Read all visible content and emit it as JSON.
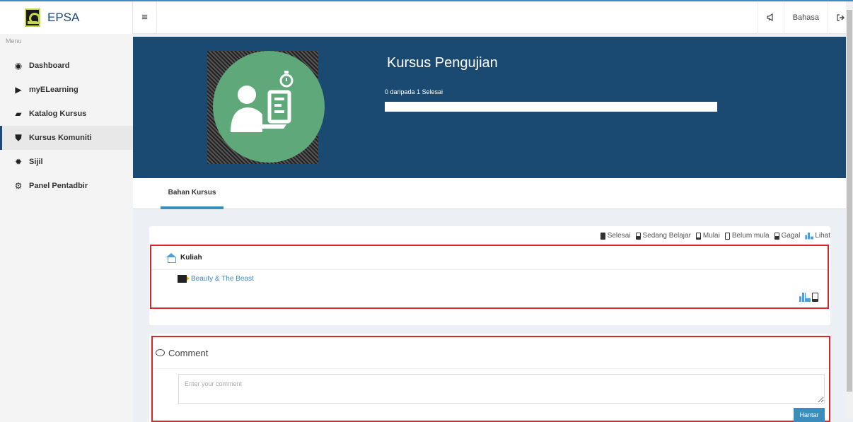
{
  "brand": {
    "name": "EPSA"
  },
  "navbar": {
    "menu_toggle": "≡",
    "announce_icon": "megaphone-icon",
    "language_label": "Bahasa",
    "logout_icon": "sign-out-icon"
  },
  "sidebar": {
    "menu_heading": "Menu",
    "items": [
      {
        "label": "Dashboard",
        "icon": "dashboard-icon",
        "glyph": "◉",
        "active": false
      },
      {
        "label": "myELearning",
        "icon": "play-square-icon",
        "glyph": "▶",
        "active": false
      },
      {
        "label": "Katalog Kursus",
        "icon": "book-icon",
        "glyph": "▰",
        "active": false
      },
      {
        "label": "Kursus Komuniti",
        "icon": "shield-icon",
        "glyph": "⛊",
        "active": true
      },
      {
        "label": "Sijil",
        "icon": "certificate-icon",
        "glyph": "✹",
        "active": false
      },
      {
        "label": "Panel Pentadbir",
        "icon": "cogs-icon",
        "glyph": "⚙",
        "active": false
      }
    ]
  },
  "course": {
    "title": "Kursus Pengujian",
    "progress_text": "0 daripada 1 Selesai",
    "progress_fraction": 0
  },
  "tabs": [
    {
      "label": "Bahan Kursus",
      "active": true
    }
  ],
  "legend": {
    "selesai": "Selesai",
    "sedang_belajar": "Sedang Belajar",
    "mulai": "Mulai",
    "belum_mula": "Belum mula",
    "gagal": "Gagal",
    "lihat": "Lihat"
  },
  "section": {
    "title": "Kuliah",
    "lessons": [
      {
        "title": "Beauty & The Beast",
        "icon": "video-icon"
      }
    ]
  },
  "comment": {
    "title": "Comment",
    "placeholder": "Enter your comment",
    "submit_label": "Hantar"
  },
  "colors": {
    "hero_bg": "#1a4a72",
    "accent": "#3c8dbc",
    "highlight_border": "#d9262c",
    "circle": "#5ea87a"
  }
}
